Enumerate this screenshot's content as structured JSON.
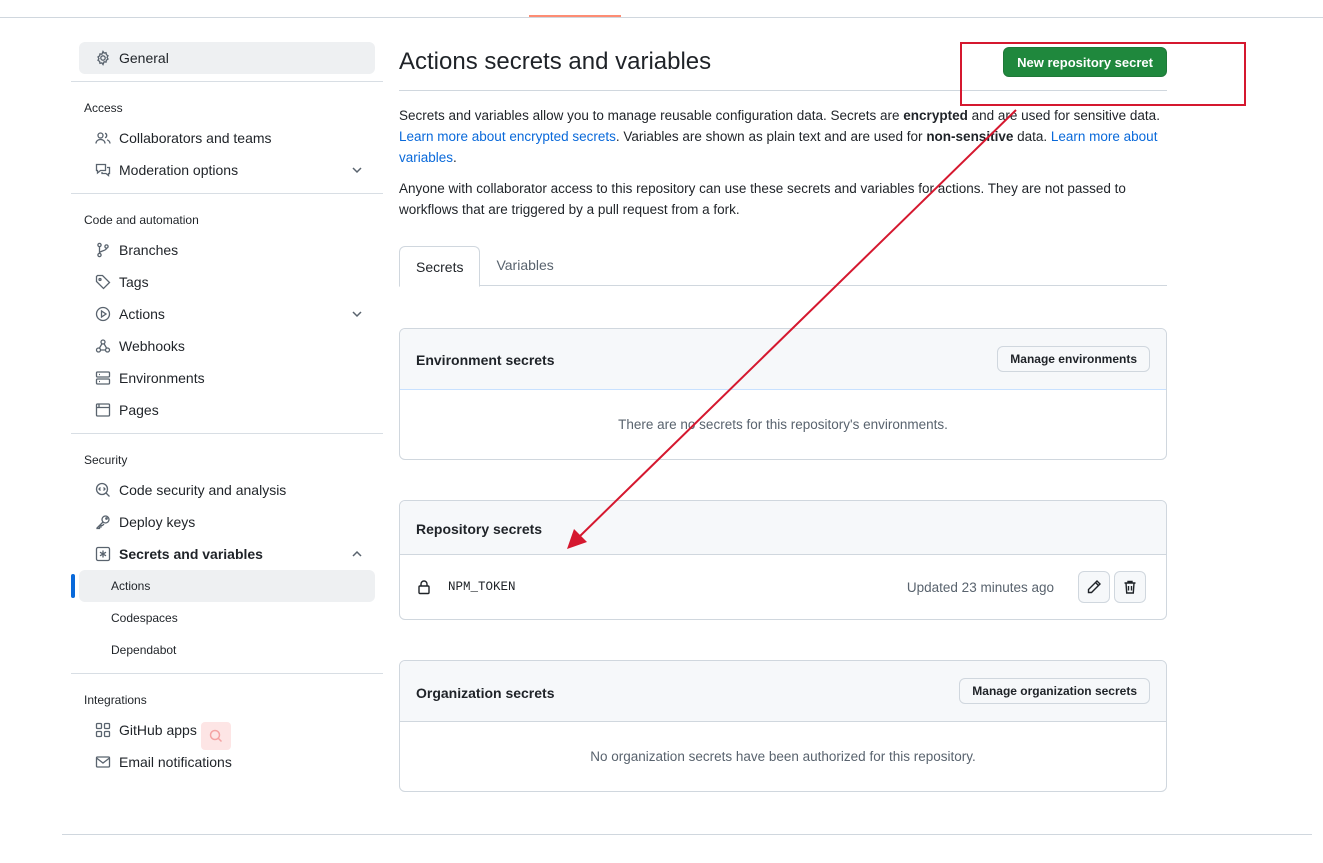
{
  "sidebar": {
    "general": "General",
    "groups": {
      "access": "Access",
      "code_automation": "Code and automation",
      "security": "Security",
      "integrations": "Integrations"
    },
    "items": {
      "collaborators": "Collaborators and teams",
      "moderation": "Moderation options",
      "branches": "Branches",
      "tags": "Tags",
      "actions": "Actions",
      "webhooks": "Webhooks",
      "environments": "Environments",
      "pages": "Pages",
      "code_security": "Code security and analysis",
      "deploy_keys": "Deploy keys",
      "secrets_variables": "Secrets and variables",
      "sub_actions": "Actions",
      "sub_codespaces": "Codespaces",
      "sub_dependabot": "Dependabot",
      "github_apps": "GitHub apps",
      "email_notifications": "Email notifications"
    }
  },
  "main": {
    "title": "Actions secrets and variables",
    "new_secret_button": "New repository secret",
    "desc1": {
      "p1": "Secrets and variables allow you to manage reusable configuration data. Secrets are ",
      "bold1": "encrypted",
      "p2": " and are used for sensitive data. ",
      "link1": "Learn more about encrypted secrets",
      "p3": ". Variables are shown as plain text and are used for ",
      "bold2": "non-sensitive",
      "p4": " data. ",
      "link2": "Learn more about variables",
      "p5": "."
    },
    "desc2": "Anyone with collaborator access to this repository can use these secrets and variables for actions. They are not passed to workflows that are triggered by a pull request from a fork.",
    "tabs": [
      "Secrets",
      "Variables"
    ],
    "environment": {
      "title": "Environment secrets",
      "button": "Manage environments",
      "empty": "There are no secrets for this repository's environments."
    },
    "repository": {
      "title": "Repository secrets",
      "secrets": [
        {
          "name": "NPM_TOKEN",
          "updated": "Updated 23 minutes ago"
        }
      ]
    },
    "organization": {
      "title": "Organization secrets",
      "button": "Manage organization secrets",
      "empty": "No organization secrets have been authorized for this repository."
    }
  },
  "colors": {
    "primary_button": "#1f883d",
    "link": "#0969da",
    "annotation": "#d5182f",
    "selected_indicator": "#0969da"
  }
}
